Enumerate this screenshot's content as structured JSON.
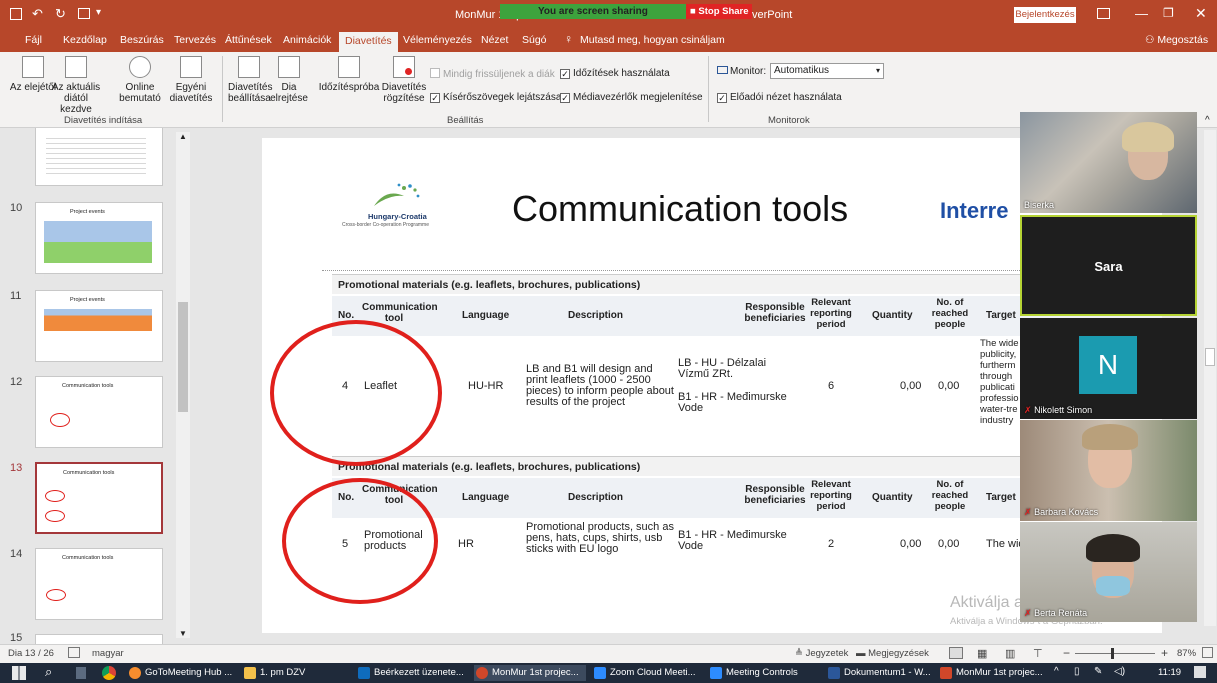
{
  "titlebar": {
    "doc_title_left": "MonMur 1st pr",
    "doc_title_right": "verPoint",
    "sharing_text": "You are screen sharing",
    "stop_share": "Stop Share",
    "signin": "Bejelentkezés"
  },
  "tabs": [
    "Fájl",
    "Kezdőlap",
    "Beszúrás",
    "Tervezés",
    "Áttűnések",
    "Animációk",
    "Diavetítés",
    "Véleményezés",
    "Nézet",
    "Súgó"
  ],
  "active_tab": "Diavetítés",
  "tellme": "Mutasd meg, hogyan csináljam",
  "share": "Megosztás",
  "ribbon": {
    "from_beginning": "Az elejétől",
    "from_current": "Az aktuális diától kezdve",
    "online": "Online bemutató",
    "custom": "Egyéni diavetítés",
    "setup": "Diavetítés beállítása",
    "hide": "Dia elrejtése",
    "rehearse": "Időzítéspróba",
    "record": "Diavetítés rögzítése",
    "group_start": "Diavetítés indítása",
    "group_setup": "Beállítás",
    "group_monitors": "Monitorok",
    "chk_keep_fresh": "Mindig frissüljenek a diák",
    "chk_timings": "Időzítések használata",
    "chk_narrations": "Kísérőszövegek lejátszása",
    "chk_media": "Médiavezérlők megjelenítése",
    "monitor_label": "Monitor:",
    "monitor_value": "Automatikus",
    "chk_presenter": "Előadói nézet használata"
  },
  "thumbs": [
    {
      "num": "10",
      "title": "Project events"
    },
    {
      "num": "11",
      "title": "Project events"
    },
    {
      "num": "12",
      "title": "Communication tools"
    },
    {
      "num": "13",
      "title": "Communication tools"
    },
    {
      "num": "14",
      "title": "Communication tools"
    },
    {
      "num": "15",
      "title": ""
    }
  ],
  "slide": {
    "logo_name": "Hungary-Croatia",
    "logo_sub": "Cross-border Co-operation Programme",
    "title": "Communication tools",
    "interreg": "Interre",
    "section1": "Promotional materials (e.g. leaflets, brochures, publications)",
    "section2": "Promotional materials (e.g. leaflets, brochures, publications)",
    "headers": {
      "no": "No.",
      "tool": "Communication tool",
      "language": "Language",
      "description": "Description",
      "responsible": "Responsible beneficiaries",
      "period": "Relevant reporting period",
      "quantity": "Quantity",
      "reached": "No. of reached people",
      "target": "Target"
    },
    "row1": {
      "no": "4",
      "tool": "Leaflet",
      "language": "HU-HR",
      "description": "LB and B1 will design and print leaflets (1000 - 2500 pieces) to inform people about results of the project",
      "resp1": "LB - HU - Délzalai Vízmű ZRt.",
      "resp2": "B1 - HR - Međimurske Vode",
      "period": "6",
      "quantity": "0,00",
      "reached": "0,00",
      "target": "The wide publicity, furtherm through publicati professio water-tre industry"
    },
    "row2": {
      "no": "5",
      "tool": "Promotional products",
      "language": "HR",
      "description": "Promotional products, such as pens, hats, cups, shirts, usb sticks with EU logo",
      "resp": "B1 - HR - Međimurske Vode",
      "period": "2",
      "quantity": "0,00",
      "reached": "0,00",
      "target": "The wide"
    }
  },
  "watermark": {
    "line1": "Aktiválja a Windows-t",
    "line2": "Aktiválja a Windows-t a Gépházban."
  },
  "participants": [
    {
      "name": "Biserka"
    },
    {
      "name": "Sara"
    },
    {
      "name": "Nikolett Simon",
      "initial": "N"
    },
    {
      "name": "Barbara Kovács"
    },
    {
      "name": "Berta Renáta"
    }
  ],
  "status": {
    "slide": "Dia 13 / 26",
    "language": "magyar",
    "notes": "Jegyzetek",
    "comments": "Megjegyzések",
    "zoom": "87%"
  },
  "taskbar": {
    "items": [
      "GoToMeeting Hub ...",
      "1. pm DZV",
      "Beérkezett üzenete...",
      "MonMur 1st projec...",
      "Zoom Cloud Meeti...",
      "Meeting Controls",
      "Dokumentum1 - W...",
      "MonMur 1st projec..."
    ],
    "time": "11:19"
  },
  "colors": {
    "accent": "#b7472a",
    "circle": "#e0201c",
    "green_share": "#3da33d",
    "stop": "#e02424"
  }
}
